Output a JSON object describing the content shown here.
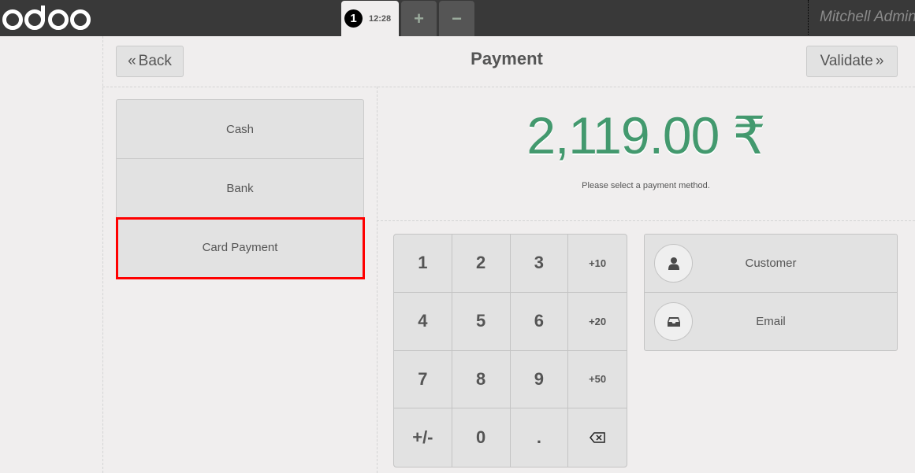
{
  "topbar": {
    "logo_text": "odoo",
    "order_tab": {
      "number": "1",
      "time": "12:28"
    },
    "add_order_icon": "+",
    "remove_order_icon": "−",
    "user_name": "Mitchell Admin"
  },
  "header": {
    "back_label": "Back",
    "back_icon": "«",
    "title": "Payment",
    "validate_label": "Validate",
    "validate_icon": "»"
  },
  "payment_methods": [
    {
      "label": "Cash"
    },
    {
      "label": "Bank"
    },
    {
      "label": "Card Payment",
      "highlighted": true
    }
  ],
  "total": {
    "amount": "2,119.00 ₹",
    "message": "Please select a payment method."
  },
  "numpad": {
    "keys": [
      "1",
      "2",
      "3",
      "+10",
      "4",
      "5",
      "6",
      "+20",
      "7",
      "8",
      "9",
      "+50",
      "+/-",
      "0",
      ".",
      "backspace"
    ]
  },
  "client_actions": [
    {
      "label": "Customer",
      "icon": "user-icon"
    },
    {
      "label": "Email",
      "icon": "inbox-icon"
    }
  ],
  "colors": {
    "topbar": "#393939",
    "amount": "#43996e",
    "highlight": "#ff0000",
    "background": "#f0eeee"
  }
}
